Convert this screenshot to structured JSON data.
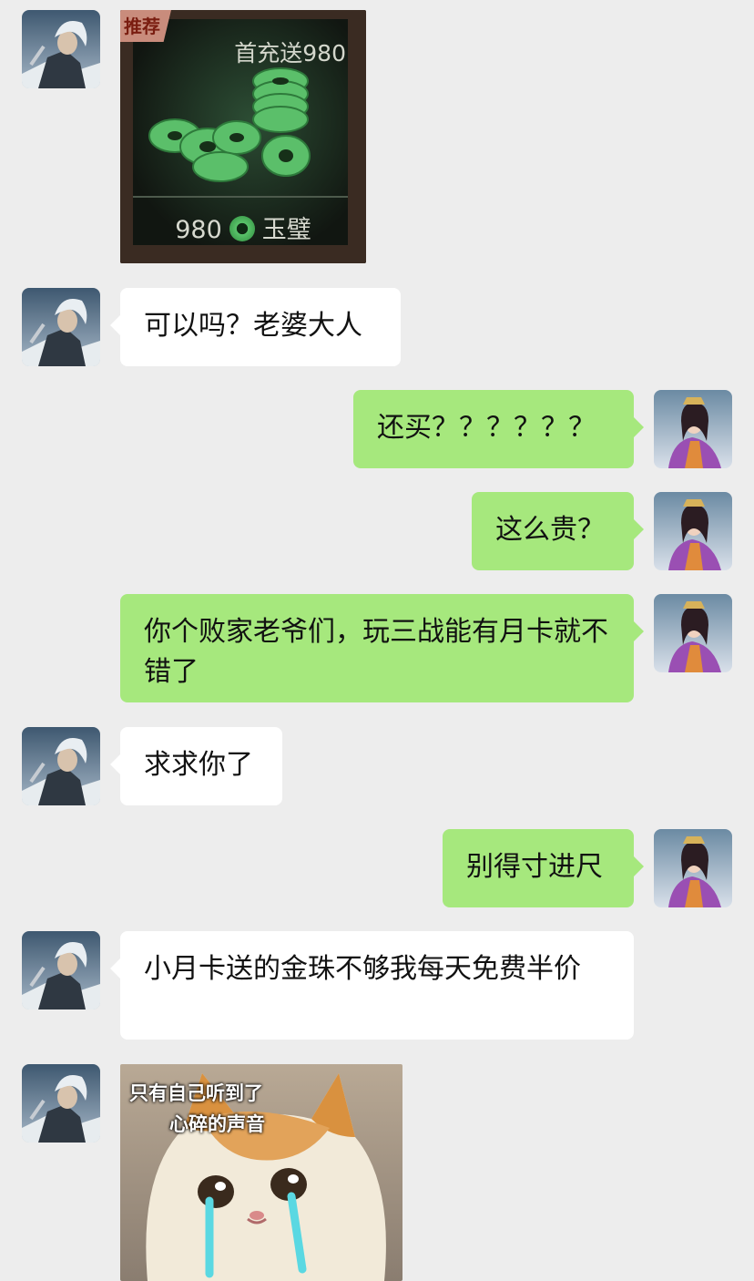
{
  "chat": {
    "messages": [
      {
        "side": "in",
        "type": "image"
      },
      {
        "side": "in",
        "type": "text",
        "text": "可以吗？老婆大人"
      },
      {
        "side": "out",
        "type": "text",
        "text": "还买？？？？？？"
      },
      {
        "side": "out",
        "type": "text",
        "text": "这么贵？"
      },
      {
        "side": "out",
        "type": "text",
        "text": "你个败家老爷们，玩三战能有月卡就不错了"
      },
      {
        "side": "in",
        "type": "text",
        "text": "求求你了"
      },
      {
        "side": "out",
        "type": "text",
        "text": "别得寸进尺"
      },
      {
        "side": "in",
        "type": "text",
        "text": "小月卡送的金珠不够我每天免费半价"
      },
      {
        "side": "in",
        "type": "image"
      }
    ]
  },
  "promo_card": {
    "tag": "推荐",
    "headline": "首充送980",
    "amount": "980",
    "currency": "玉璧"
  },
  "meme": {
    "caption_line1": "只有自己听到了",
    "caption_line2": "心碎的声音"
  },
  "colors": {
    "background": "#ededed",
    "incoming_bubble": "#ffffff",
    "outgoing_bubble": "#a6e87d"
  }
}
